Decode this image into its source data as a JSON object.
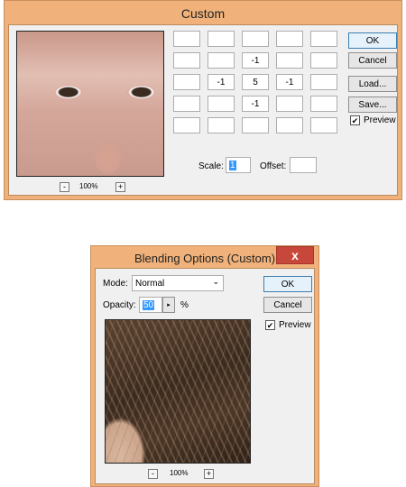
{
  "custom_dialog": {
    "title": "Custom",
    "kernel": [
      [
        "",
        "",
        "",
        "",
        ""
      ],
      [
        "",
        "",
        "-1",
        "",
        ""
      ],
      [
        "",
        "-1",
        "5",
        "-1",
        ""
      ],
      [
        "",
        "",
        "-1",
        "",
        ""
      ],
      [
        "",
        "",
        "",
        "",
        ""
      ]
    ],
    "scale_label": "Scale:",
    "scale_value": "1",
    "offset_label": "Offset:",
    "offset_value": "",
    "ok_label": "OK",
    "cancel_label": "Cancel",
    "load_label": "Load...",
    "save_label": "Save...",
    "preview_label": "Preview",
    "preview_checked": true,
    "zoom_level": "100%",
    "zoom_out": "-",
    "zoom_in": "+"
  },
  "blend_dialog": {
    "title": "Blending Options (Custom)",
    "close_glyph": "x",
    "mode_label": "Mode:",
    "mode_value": "Normal",
    "opacity_label": "Opacity:",
    "opacity_value": "50",
    "opacity_unit": "%",
    "ok_label": "OK",
    "cancel_label": "Cancel",
    "preview_label": "Preview",
    "preview_checked": true,
    "zoom_level": "100%",
    "zoom_out": "-",
    "zoom_in": "+"
  },
  "colors": {
    "window_frame": "#f0b27a",
    "client_bg": "#f0f0f0",
    "close_red": "#c7473b",
    "selection_blue": "#3399ff"
  }
}
